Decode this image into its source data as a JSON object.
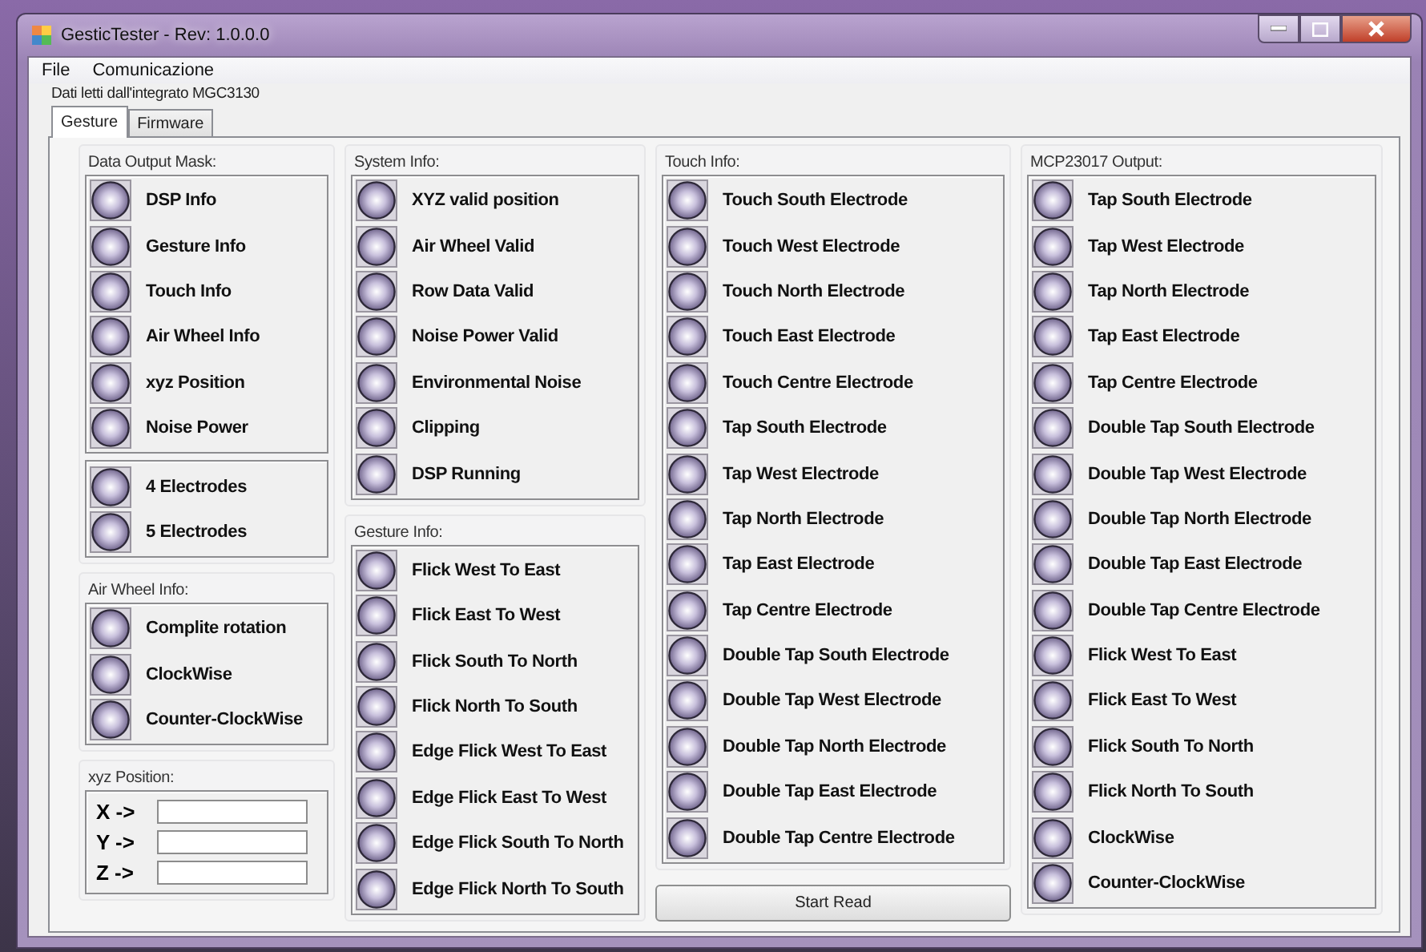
{
  "window": {
    "title": "GesticTester - Rev: 1.0.0.0"
  },
  "menu": [
    "File",
    "Comunicazione"
  ],
  "caption": "Dati letti dall'integrato MGC3130",
  "tabs": [
    {
      "label": "Gesture",
      "selected": true
    },
    {
      "label": "Firmware",
      "selected": false
    }
  ],
  "columns": [
    [
      {
        "kind": "leds",
        "title": "Data Output Mask:",
        "boxes": [
          [
            "DSP Info",
            "Gesture Info",
            "Touch Info",
            "Air Wheel Info",
            "xyz Position",
            "Noise Power"
          ],
          [
            "4 Electrodes",
            "5 Electrodes"
          ]
        ]
      },
      {
        "kind": "leds",
        "title": "Air Wheel Info:",
        "boxes": [
          [
            "Complite rotation",
            "ClockWise",
            "Counter-ClockWise"
          ]
        ]
      },
      {
        "kind": "fields",
        "title": "xyz Position:",
        "fields": [
          {
            "label": "X ->"
          },
          {
            "label": "Y ->"
          },
          {
            "label": "Z ->"
          }
        ]
      }
    ],
    [
      {
        "kind": "leds",
        "title": "System Info:",
        "boxes": [
          [
            "XYZ valid position",
            "Air Wheel Valid",
            "Row Data Valid",
            "Noise Power Valid",
            "Environmental Noise",
            "Clipping",
            "DSP Running"
          ]
        ]
      },
      {
        "kind": "leds",
        "title": "Gesture Info:",
        "boxes": [
          [
            "Flick West To East",
            "Flick East To West",
            "Flick South To North",
            "Flick North To South",
            "Edge Flick West To East",
            "Edge Flick East To West",
            "Edge Flick South To North",
            "Edge Flick North To South"
          ]
        ]
      }
    ],
    [
      {
        "kind": "leds",
        "title": "Touch Info:",
        "boxes": [
          [
            "Touch South Electrode",
            "Touch West Electrode",
            "Touch North Electrode",
            "Touch East Electrode",
            "Touch Centre Electrode",
            "Tap South Electrode",
            "Tap West Electrode",
            "Tap North Electrode",
            "Tap East Electrode",
            "Tap Centre Electrode",
            "Double Tap South Electrode",
            "Double Tap West Electrode",
            "Double Tap North Electrode",
            "Double Tap East Electrode",
            "Double Tap Centre Electrode"
          ]
        ]
      },
      {
        "kind": "button",
        "label": "Start Read"
      }
    ],
    [
      {
        "kind": "leds",
        "title": "MCP23017 Output:",
        "boxes": [
          [
            "Tap South Electrode",
            "Tap West Electrode",
            "Tap North Electrode",
            "Tap East Electrode",
            "Tap Centre Electrode",
            "Double Tap South Electrode",
            "Double Tap West Electrode",
            "Double Tap North Electrode",
            "Double Tap East Electrode",
            "Double Tap Centre Electrode",
            "Flick West To East",
            "Flick East To West",
            "Flick South To North",
            "Flick North To South",
            "ClockWise",
            "Counter-ClockWise"
          ]
        ]
      }
    ]
  ]
}
